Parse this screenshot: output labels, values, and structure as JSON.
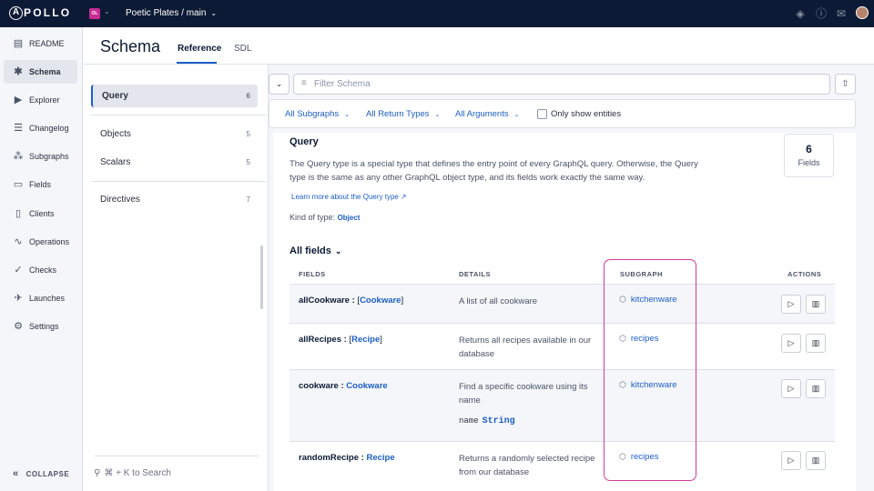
{
  "topbar": {
    "logo": "APOLLO",
    "org_badge": "OL",
    "graph_name": "Poetic Plates / main",
    "icons": [
      "learn-icon",
      "help-icon",
      "announcement-icon",
      "user-avatar"
    ]
  },
  "sidebar": {
    "items": [
      {
        "label": "README",
        "icon": "readme-icon"
      },
      {
        "label": "Schema",
        "icon": "schema-icon",
        "active": true
      },
      {
        "label": "Explorer",
        "icon": "explorer-icon"
      },
      {
        "label": "Changelog",
        "icon": "changelog-icon"
      },
      {
        "label": "Subgraphs",
        "icon": "subgraphs-icon"
      },
      {
        "label": "Fields",
        "icon": "fields-icon"
      },
      {
        "label": "Clients",
        "icon": "clients-icon"
      },
      {
        "label": "Operations",
        "icon": "operations-icon"
      },
      {
        "label": "Checks",
        "icon": "checks-icon"
      },
      {
        "label": "Launches",
        "icon": "launches-icon"
      },
      {
        "label": "Settings",
        "icon": "settings-icon"
      }
    ],
    "collapse_label": "COLLAPSE"
  },
  "page": {
    "title": "Schema",
    "tabs": [
      {
        "label": "Reference",
        "active": true
      },
      {
        "label": "SDL",
        "active": false
      }
    ]
  },
  "types": {
    "items": [
      {
        "label": "Query",
        "count": "6",
        "active": true
      },
      {
        "label": "Objects",
        "count": "5"
      },
      {
        "label": "Scalars",
        "count": "5"
      },
      {
        "label": "Directives",
        "count": "7"
      }
    ],
    "search_hint": "⌘ + K to Search"
  },
  "toolbar": {
    "filter_placeholder": "Filter Schema",
    "filters": [
      "All Subgraphs",
      "All Return Types",
      "All Arguments"
    ],
    "entities_checkbox": "Only show entities",
    "entities_checked": false
  },
  "detail": {
    "title": "Query",
    "description": "The Query type is a special type that defines the entry point of every GraphQL query. Otherwise, the Query type is the same as any other GraphQL object type, and its fields work exactly the same way.",
    "learn_more": "Learn more about the Query type",
    "kind_label": "Kind of type:",
    "kind_value": "Object",
    "fields_count": "6",
    "fields_count_label": "Fields",
    "all_fields_label": "All fields"
  },
  "table": {
    "headers": [
      "FIELDS",
      "DETAILS",
      "SUBGRAPH",
      "ACTIONS"
    ],
    "rows": [
      {
        "name": "allCookware",
        "sep": " : ",
        "open": "[",
        "type": "Cookware",
        "close": "]",
        "description": "A list of all cookware",
        "arg_name": "",
        "arg_type": "",
        "subgraph": "kitchenware"
      },
      {
        "name": "allRecipes",
        "sep": " : ",
        "open": "[",
        "type": "Recipe",
        "close": "]",
        "description": "Returns all recipes available in our database",
        "arg_name": "",
        "arg_type": "",
        "subgraph": "recipes"
      },
      {
        "name": "cookware",
        "sep": " : ",
        "open": "",
        "type": "Cookware",
        "close": "",
        "description": "Find a specific cookware using its name",
        "arg_name": "name",
        "arg_type": "String",
        "subgraph": "kitchenware"
      },
      {
        "name": "randomRecipe",
        "sep": " : ",
        "open": "",
        "type": "Recipe",
        "close": "",
        "description": "Returns a randomly selected recipe from our database",
        "arg_name": "",
        "arg_type": "",
        "subgraph": "recipes"
      }
    ]
  },
  "colors": {
    "topbar": "#0d1a35",
    "accent": "#1c5ec7",
    "highlight": "#d23d9a"
  }
}
